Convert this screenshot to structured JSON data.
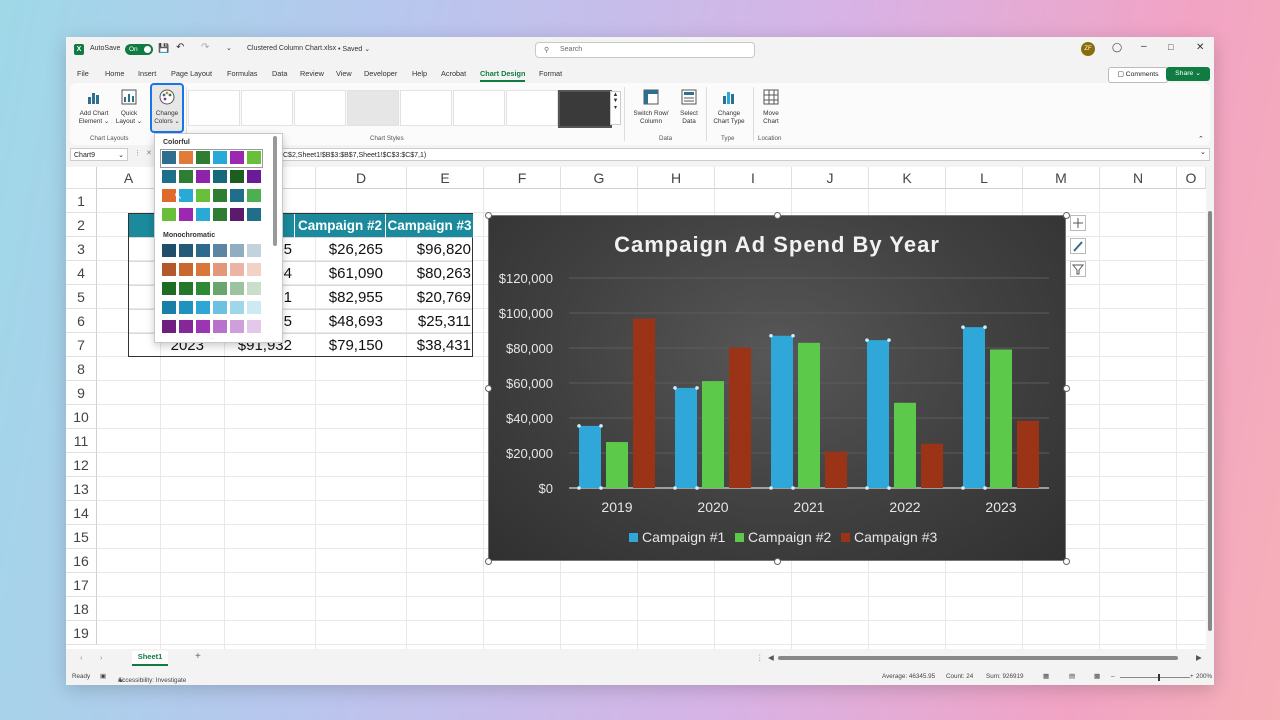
{
  "titlebar": {
    "autosave_label": "AutoSave",
    "autosave_state": "On",
    "filename": "Clustered Column Chart.xlsx",
    "saved_state": "Saved",
    "search_placeholder": "Search",
    "user_initials": "ZF"
  },
  "menu": {
    "tabs": [
      "File",
      "Home",
      "Insert",
      "Page Layout",
      "Formulas",
      "Data",
      "Review",
      "View",
      "Developer",
      "Help",
      "Acrobat",
      "Chart Design",
      "Format"
    ],
    "active_tab": "Chart Design",
    "comments_label": "Comments",
    "share_label": "Share"
  },
  "ribbon": {
    "add_chart_element": [
      "Add Chart",
      "Element"
    ],
    "quick_layout": [
      "Quick",
      "Layout"
    ],
    "change_colors": [
      "Change",
      "Colors"
    ],
    "group_chart_layouts": "Chart Layouts",
    "group_chart_styles": "Chart Styles",
    "switch_row_column": [
      "Switch Row/",
      "Column"
    ],
    "select_data": [
      "Select",
      "Data"
    ],
    "group_data": "Data",
    "change_chart_type": [
      "Change",
      "Chart Type"
    ],
    "group_type": "Type",
    "move_chart": [
      "Move",
      "Chart"
    ],
    "group_location": "Location"
  },
  "formula_bar": {
    "name_box": "Chart9",
    "formula": "C$2,Sheet1!$B$3:$B$7,Sheet1!$C$3:$C$7,1)"
  },
  "grid": {
    "columns": [
      "A",
      "B",
      "C",
      "D",
      "E",
      "F",
      "G",
      "H",
      "I",
      "J",
      "K",
      "L",
      "M",
      "N",
      "O"
    ],
    "rows": [
      "1",
      "2",
      "3",
      "4",
      "5",
      "6",
      "7",
      "8",
      "9",
      "10",
      "11",
      "12",
      "13",
      "14",
      "15",
      "16",
      "17",
      "18",
      "19"
    ]
  },
  "table": {
    "headers": [
      "Y",
      "1",
      "Campaign #2",
      "Campaign #3"
    ],
    "rows": [
      {
        "year": "",
        "c1": "05",
        "c2": "$26,265",
        "c3": "$96,820"
      },
      {
        "year": "",
        "c1": "04",
        "c2": "$61,090",
        "c3": "$80,263"
      },
      {
        "year": "",
        "c1": "21",
        "c2": "$82,955",
        "c3": "$20,769"
      },
      {
        "year": "",
        "c1": "25",
        "c2": "$48,693",
        "c3": "$25,311"
      },
      {
        "year": "2023",
        "c1": "$91,932",
        "c2": "$79,150",
        "c3": "$38,431"
      }
    ]
  },
  "dropdown": {
    "colorful_label": "Colorful",
    "monochromatic_label": "Monochromatic",
    "colorful_rows": [
      [
        "#2e6f8e",
        "#e07b39",
        "#2e7d32",
        "#28a9d6",
        "#9c27b0",
        "#6abf3a"
      ],
      [
        "#1f6f8b",
        "#2e7d32",
        "#8e24aa",
        "#16697a",
        "#1b5e20",
        "#6a1b9a"
      ],
      [
        "#e06a2c",
        "#28a9d6",
        "#6abf3a",
        "#2e7d32",
        "#1f6f8b",
        "#4caf50"
      ],
      [
        "#6abf3a",
        "#9c27b0",
        "#28a9d6",
        "#2e7d32",
        "#5b1a6b",
        "#1f6f8b"
      ]
    ],
    "mono_rows": [
      [
        "#1f4e6b",
        "#25597a",
        "#2e6a8e",
        "#5b86a3",
        "#90aec2",
        "#c2d3de"
      ],
      [
        "#b3582a",
        "#c9672f",
        "#d9773a",
        "#e2977a",
        "#ecb5a3",
        "#f3d1c6"
      ],
      [
        "#1e6b23",
        "#23782a",
        "#2f8a35",
        "#6aa56e",
        "#9cc29e",
        "#cadfcb"
      ],
      [
        "#1a7fa6",
        "#1f93bf",
        "#2ea7d4",
        "#6cc0e0",
        "#a0d6ea",
        "#cce9f4"
      ],
      [
        "#6e1f7f",
        "#85279a",
        "#9c35b3",
        "#b872c9",
        "#cf9fda",
        "#e4c8ea"
      ]
    ]
  },
  "chart_data": {
    "type": "bar",
    "title": "Campaign Ad Spend By Year",
    "categories": [
      "2019",
      "2020",
      "2021",
      "2022",
      "2023"
    ],
    "series": [
      {
        "name": "Campaign #1",
        "color": "#2fa7d8",
        "values": [
          35500,
          57200,
          87000,
          84500,
          91932
        ]
      },
      {
        "name": "Campaign #2",
        "color": "#5cc94a",
        "values": [
          26265,
          61090,
          82955,
          48693,
          79150
        ]
      },
      {
        "name": "Campaign #3",
        "color": "#9b3417",
        "values": [
          96820,
          80263,
          20769,
          25311,
          38431
        ]
      }
    ],
    "ylim": [
      0,
      120000
    ],
    "yticks": [
      "$0",
      "$20,000",
      "$40,000",
      "$60,000",
      "$80,000",
      "$100,000",
      "$120,000"
    ],
    "grid": true,
    "legend": "bottom"
  },
  "sheet": {
    "tab": "Sheet1"
  },
  "status": {
    "ready": "Ready",
    "accessibility": "Accessibility: Investigate",
    "average": "Average: 46345.95",
    "count": "Count: 24",
    "sum": "Sum: 926919",
    "zoom": "200%"
  }
}
